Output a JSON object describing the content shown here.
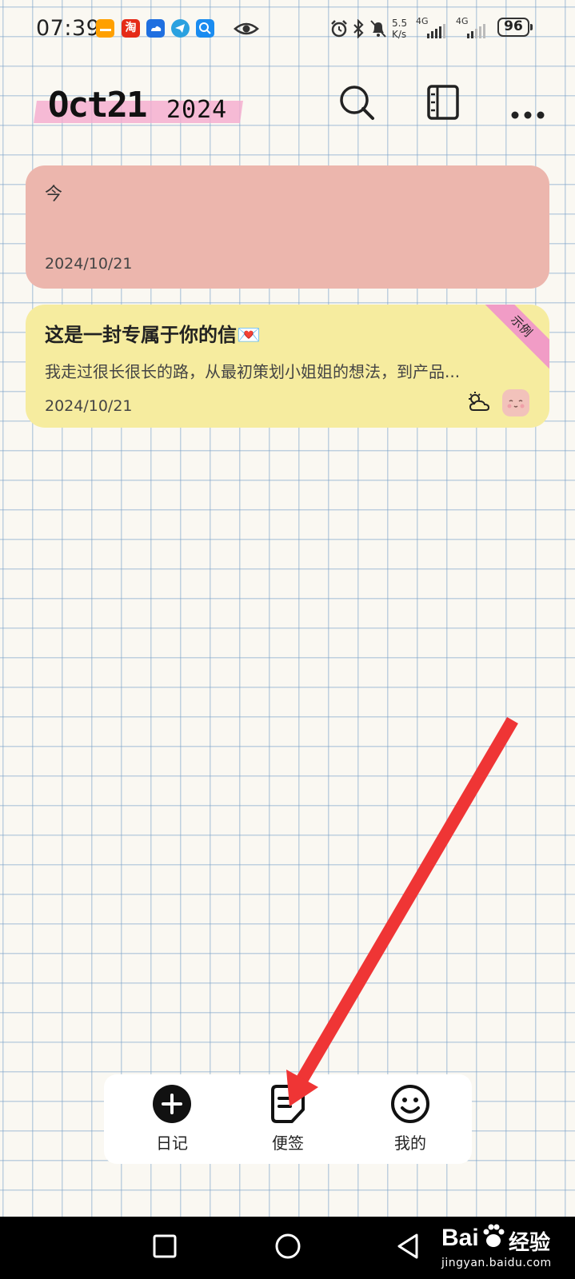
{
  "status_bar": {
    "time": "07:39",
    "net_speed_value": "5.5",
    "net_speed_unit": "K/s",
    "signal_1": "4G",
    "signal_2": "4G",
    "battery": "96",
    "app_icons": [
      "notes-app-icon",
      "taobao-app-icon",
      "cloud-app-icon",
      "telegram-app-icon",
      "search-app-icon"
    ],
    "taobao_char": "淘"
  },
  "header": {
    "date_main": "Oct21",
    "date_year": "2024",
    "tape_color": "#f5aacd"
  },
  "entries": [
    {
      "title": "今",
      "preview": "",
      "date": "2024/10/21",
      "color": "#ecb6ad"
    },
    {
      "title": "这是一封专属于你的信💌",
      "preview": "我走过很长很长的路，从最初策划小姐姐的想法，到产品...",
      "date": "2024/10/21",
      "color": "#f6ec9f",
      "badge": "示例",
      "weather_icon": "partly-cloudy-icon",
      "mood_icon": "smiling-face-icon"
    }
  ],
  "bottom_nav": {
    "items": [
      {
        "label": "日记",
        "icon": "add-circle-icon"
      },
      {
        "label": "便签",
        "icon": "note-icon"
      },
      {
        "label": "我的",
        "icon": "smile-icon"
      }
    ]
  },
  "watermark": {
    "brand": "Bai",
    "brand_cn": "经验",
    "url": "jingyan.baidu.com"
  },
  "annotation": {
    "arrow_color": "#ef3535"
  }
}
